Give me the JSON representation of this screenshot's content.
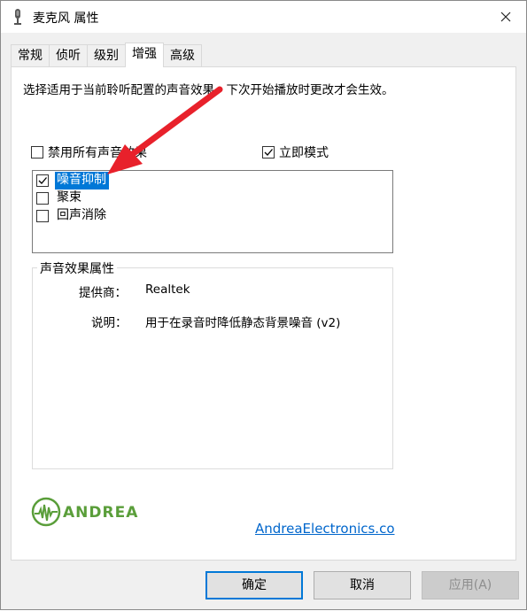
{
  "window": {
    "title": "麦克风 属性",
    "icon": "microphone-icon",
    "close_icon": "close-icon"
  },
  "tabs": [
    {
      "label": "常规",
      "active": false
    },
    {
      "label": "侦听",
      "active": false
    },
    {
      "label": "级别",
      "active": false
    },
    {
      "label": "增强",
      "active": true
    },
    {
      "label": "高级",
      "active": false
    }
  ],
  "enhancements": {
    "description": "选择适用于当前聆听配置的声音效果。下次开始播放时更改才会生效。",
    "disable_all": {
      "label": "禁用所有声音效果",
      "checked": false
    },
    "immediate_mode": {
      "label": "立即模式",
      "checked": true
    },
    "effects": [
      {
        "label": "噪音抑制",
        "checked": true,
        "selected": true
      },
      {
        "label": "聚束",
        "checked": false,
        "selected": false
      },
      {
        "label": "回声消除",
        "checked": false,
        "selected": false
      }
    ]
  },
  "properties": {
    "legend": "声音效果属性",
    "provider_label": "提供商：",
    "provider_value": "Realtek",
    "description_label": "说明：",
    "description_value": "用于在录音时降低静态背景噪音 (v2)"
  },
  "vendor": {
    "logo_text": "ANDREA",
    "link": "AndreaElectronics.co"
  },
  "buttons": {
    "ok": "确定",
    "cancel": "取消",
    "apply": "应用(A)"
  },
  "colors": {
    "selection": "#0078d7",
    "annotation_arrow": "#e8212b",
    "logo_green": "#5a9e3a",
    "link": "#0066cc"
  }
}
